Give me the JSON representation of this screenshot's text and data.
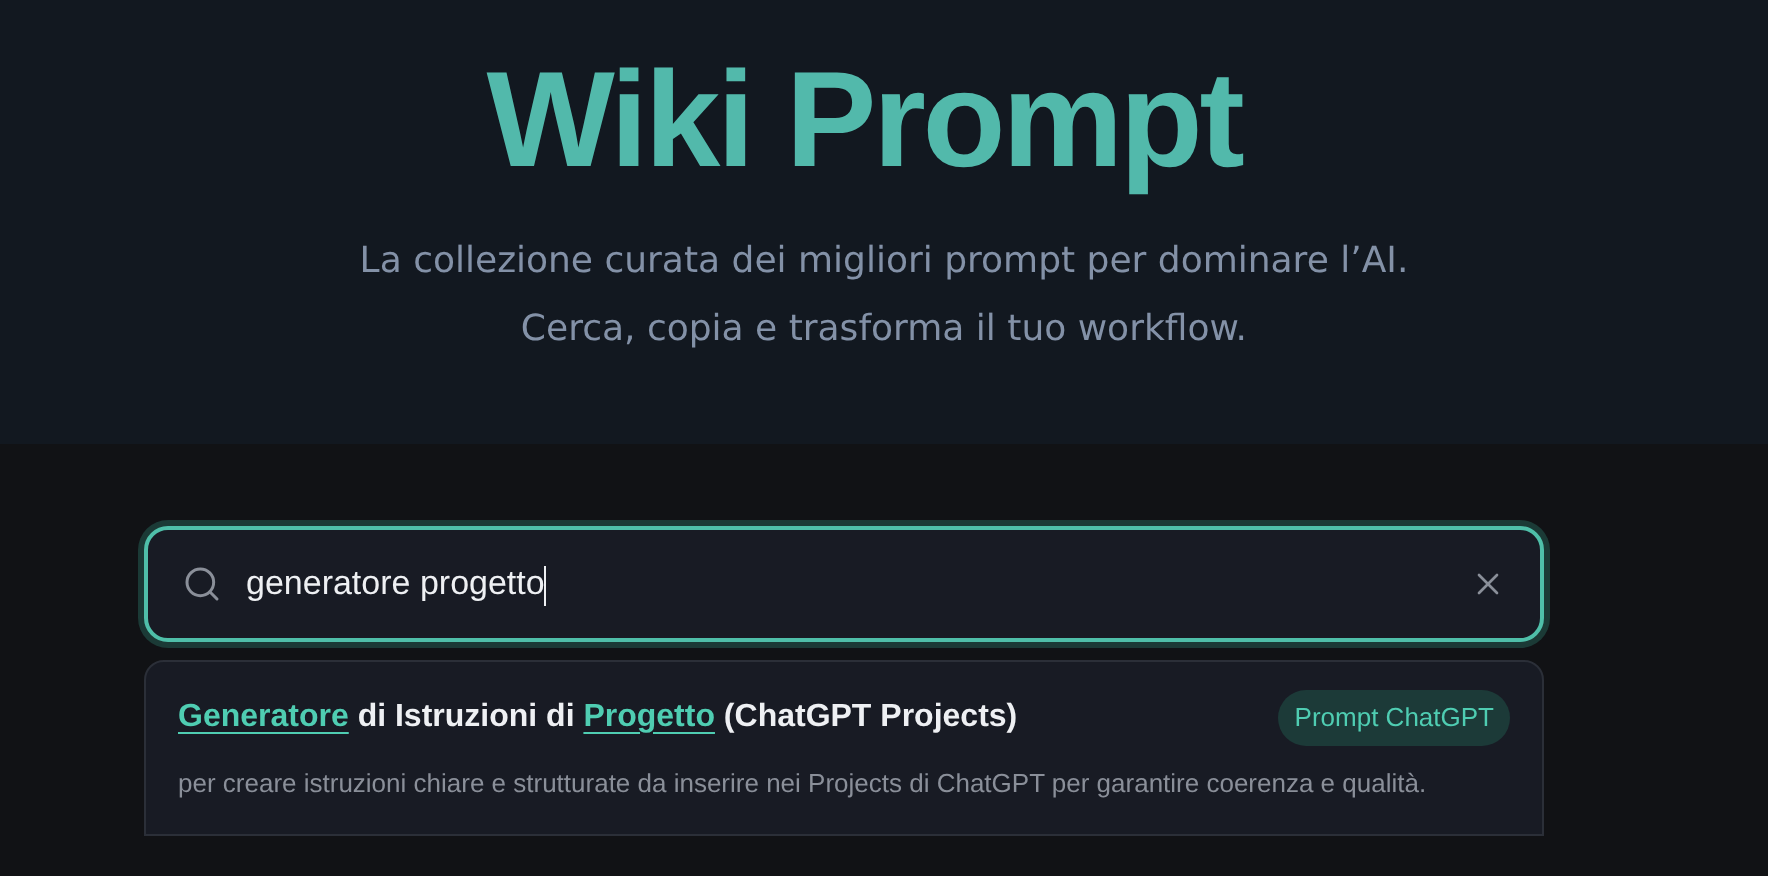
{
  "header": {
    "title": "Wiki Prompt",
    "subtitle_lines": [
      "La collezione curata dei migliori prompt per dominare l’AI.",
      "Cerca, copia e trasforma il tuo workflow."
    ]
  },
  "search": {
    "value": "generatore progetto",
    "focused": true
  },
  "results": [
    {
      "title_parts": [
        {
          "text": "Generatore",
          "match": true
        },
        {
          "text": " di Istruzioni di ",
          "match": false
        },
        {
          "text": "Progetto",
          "match": true
        },
        {
          "text": " (ChatGPT Projects)",
          "match": false
        }
      ],
      "tag": "Prompt ChatGPT",
      "description": "per creare istruzioni chiare e strutturate da inserire nei Projects di ChatGPT per garantire coerenza e qualità."
    }
  ]
}
